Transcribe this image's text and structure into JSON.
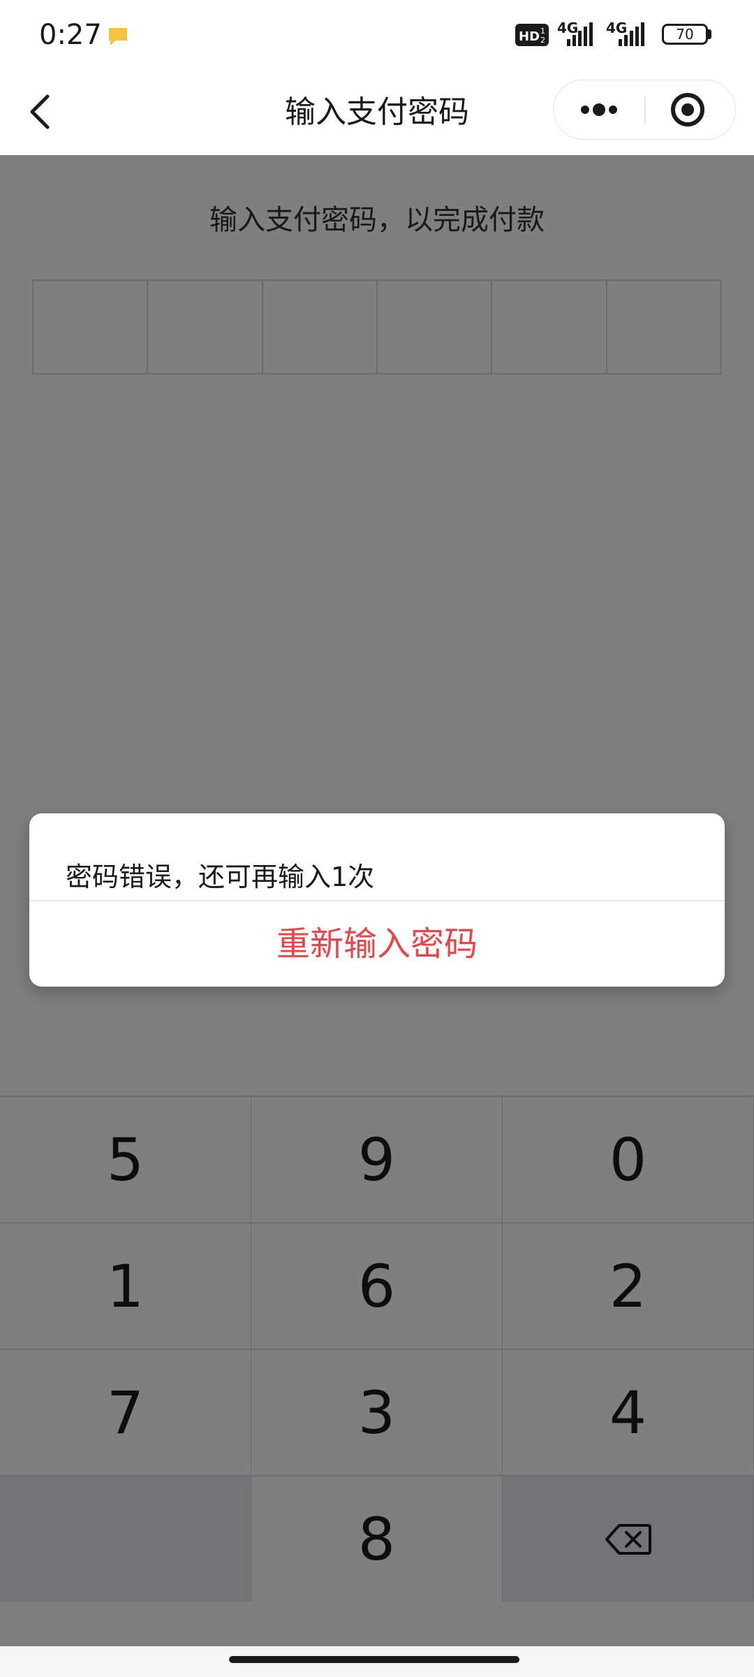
{
  "status_bar": {
    "time": "0:27",
    "hd_label": "HD",
    "network_1": "4G",
    "network_2": "4G",
    "battery": "70"
  },
  "nav": {
    "title": "输入支付密码"
  },
  "page": {
    "subtitle": "输入支付密码，以完成付款",
    "password_slots": 6
  },
  "keypad": {
    "keys": [
      "5",
      "9",
      "0",
      "1",
      "6",
      "2",
      "7",
      "3",
      "4",
      "",
      "8",
      "delete"
    ]
  },
  "dialog": {
    "message": "密码错误，还可再输入1次",
    "button_label": "重新输入密码"
  },
  "colors": {
    "accent": "#e8454a",
    "mask": "rgba(0,0,0,0.5)"
  }
}
